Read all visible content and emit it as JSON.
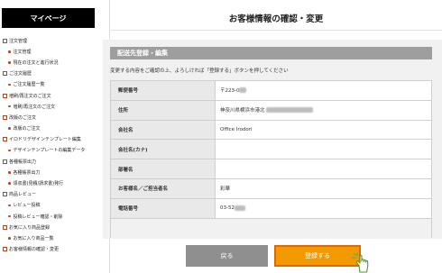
{
  "sidebar": {
    "header": "マイページ",
    "items": [
      {
        "level": 1,
        "label": "注文管理"
      },
      {
        "level": 2,
        "label": "注文管理"
      },
      {
        "level": 2,
        "label": "現在の注文と進行状況"
      },
      {
        "level": 1,
        "label": "ご注文履歴"
      },
      {
        "level": 2,
        "label": "ご注文履歴一覧"
      },
      {
        "level": 1,
        "label": "増刷/再注文のご注文"
      },
      {
        "level": 2,
        "label": "増刷/再注文のご注文"
      },
      {
        "level": 1,
        "label": "改版のご注文"
      },
      {
        "level": 2,
        "label": "改版のご注文"
      },
      {
        "level": 1,
        "label": "イロドリデザインテンプレート編集"
      },
      {
        "level": 2,
        "label": "デザインテンプレートの編集データ"
      },
      {
        "level": 1,
        "label": "各種帳票出力"
      },
      {
        "level": 2,
        "label": "各種帳票出力"
      },
      {
        "level": 2,
        "label": "領収書(見積/請求書)発行"
      },
      {
        "level": 1,
        "label": "商品レビュー"
      },
      {
        "level": 2,
        "label": "レビュー投稿"
      },
      {
        "level": 2,
        "label": "投稿レビュー確認・削除"
      },
      {
        "level": 1,
        "label": "お気に入り商品登録"
      },
      {
        "level": 2,
        "label": "お気に入り商品一覧"
      },
      {
        "level": 1,
        "label": "お客様情報の確認・変更"
      }
    ]
  },
  "page": {
    "title": "お客様情報の確認・変更"
  },
  "panel": {
    "header": "配送先登録・編集",
    "instruction": "変更する内容をご確認の上、よろしければ「登録する」ボタンを押してください"
  },
  "form": {
    "rows": [
      {
        "label": "郵便番号",
        "value": "〒223-0"
      },
      {
        "label": "住所",
        "value": "神奈川県横浜市港北"
      },
      {
        "label": "会社名",
        "value": "Office Irodori"
      },
      {
        "label": "会社名(カナ)",
        "value": ""
      },
      {
        "label": "部署名",
        "value": ""
      },
      {
        "label": "お客様名／ご担当者名",
        "value": "彩華"
      },
      {
        "label": "電話番号",
        "value": "03-52"
      }
    ]
  },
  "buttons": {
    "back": "戻る",
    "register": "登録する"
  },
  "icons": {
    "pointer": "hand-pointer-icon"
  },
  "colors": {
    "accent": "#f39a00",
    "accent_border": "#e06800",
    "marker": "#d03b10",
    "panel_header": "#9e9e9e"
  }
}
